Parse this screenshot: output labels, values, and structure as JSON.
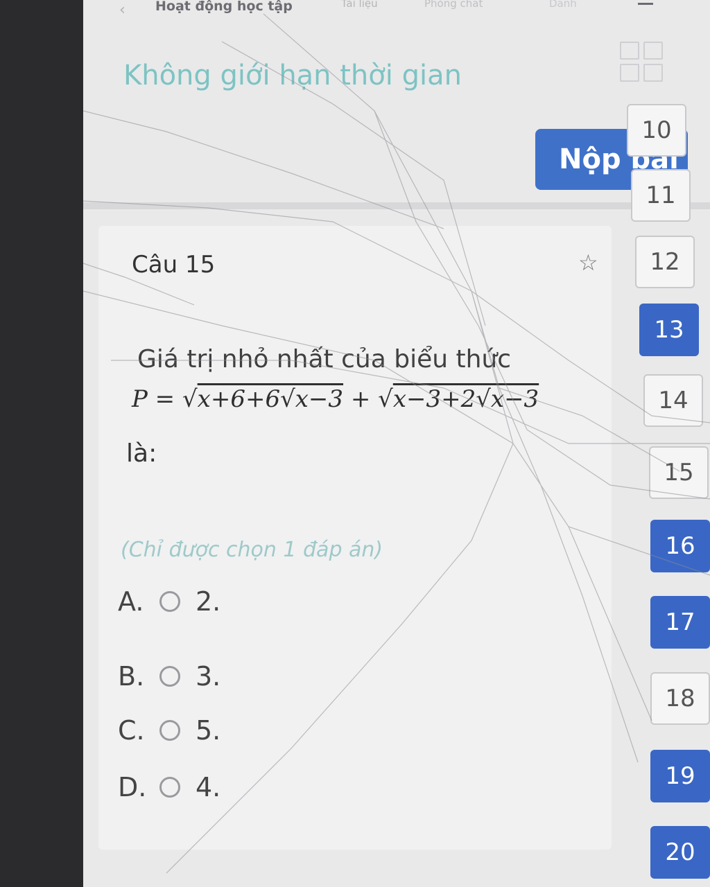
{
  "topnav": {
    "back_icon": "chevron-left-icon",
    "tabs": [
      "Hoạt động học tập",
      "Tài liệu",
      "Phòng chat",
      "Danh"
    ]
  },
  "header": {
    "time_limit": "Không giới hạn thời gian",
    "submit_label": "Nộp bài"
  },
  "question": {
    "title": "Câu 15",
    "text": "Giá trị nhỏ nhất của biểu thức",
    "formula": {
      "lhs": "P = ",
      "rad1": "x+6+6√x−3",
      "plus": " + ",
      "rad2": "x−3+2√x−3"
    },
    "text_end": "là:",
    "hint": "(Chỉ được chọn 1 đáp án)",
    "options": [
      {
        "letter": "A.",
        "value": "2."
      },
      {
        "letter": "B.",
        "value": "3."
      },
      {
        "letter": "C.",
        "value": "5."
      },
      {
        "letter": "D.",
        "value": "4."
      }
    ]
  },
  "nav_numbers": [
    {
      "label": "10",
      "state": "plain"
    },
    {
      "label": "11",
      "state": "plain"
    },
    {
      "label": "12",
      "state": "plain"
    },
    {
      "label": "13",
      "state": "done"
    },
    {
      "label": "14",
      "state": "plain"
    },
    {
      "label": "15",
      "state": "plain"
    },
    {
      "label": "16",
      "state": "done"
    },
    {
      "label": "17",
      "state": "done"
    },
    {
      "label": "18",
      "state": "plain"
    },
    {
      "label": "19",
      "state": "done"
    },
    {
      "label": "20",
      "state": "done"
    }
  ],
  "colors": {
    "accent": "#3a67c5",
    "hint": "#9fc9c9",
    "time_limit": "#7ec3c3"
  }
}
